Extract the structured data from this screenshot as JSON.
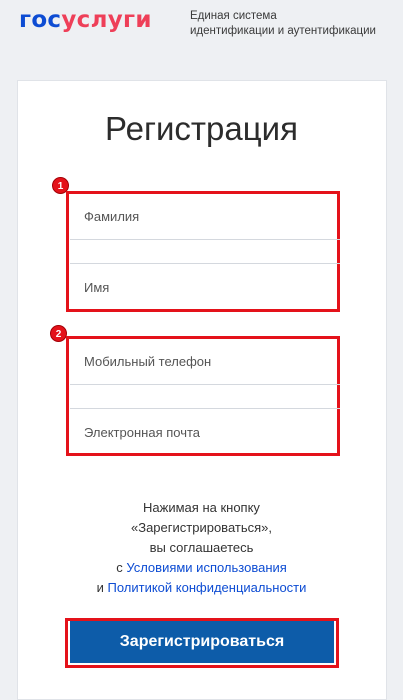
{
  "header": {
    "logo_part1": "гос",
    "logo_part2": "услуги",
    "tagline_line1": "Единая система",
    "tagline_line2": "идентификации и аутентификации"
  },
  "form": {
    "title": "Регистрация",
    "group1_badge": "1",
    "group2_badge": "2",
    "surname_placeholder": "Фамилия",
    "name_placeholder": "Имя",
    "phone_placeholder": "Мобильный телефон",
    "email_placeholder": "Электронная почта"
  },
  "terms": {
    "line1": "Нажимая на кнопку",
    "line2": "«Зарегистрироваться»,",
    "line3": "вы соглашаетесь",
    "line4_prefix": "с ",
    "line4_link": "Условиями использования",
    "line5_prefix": "и ",
    "line5_link": "Политикой конфиденциальности"
  },
  "submit_label": "Зарегистрироваться",
  "colors": {
    "brand_blue": "#0d4cd3",
    "brand_red": "#ee3f58",
    "button_blue": "#0d5ca9",
    "highlight_red": "#e4121a"
  }
}
